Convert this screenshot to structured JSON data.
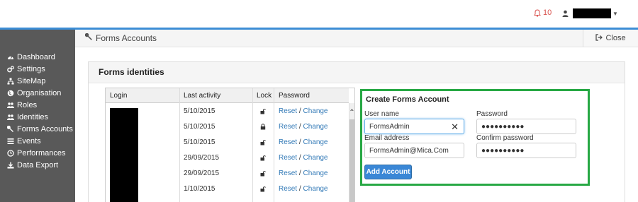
{
  "topbar": {
    "notifications_count": "10",
    "accent_color": "#3c8dd5",
    "notification_icon": "bell-icon",
    "user_icon": "user-icon"
  },
  "sidebar": {
    "items": [
      {
        "label": "Dashboard",
        "icon": "tachometer-icon"
      },
      {
        "label": "Settings",
        "icon": "cogs-icon"
      },
      {
        "label": "SiteMap",
        "icon": "sitemap-icon"
      },
      {
        "label": "Organisation",
        "icon": "globe-icon"
      },
      {
        "label": "Roles",
        "icon": "users-icon"
      },
      {
        "label": "Identities",
        "icon": "users-icon"
      },
      {
        "label": "Forms Accounts",
        "icon": "wrench-icon"
      },
      {
        "label": "Events",
        "icon": "list-icon"
      },
      {
        "label": "Performances",
        "icon": "clock-icon"
      },
      {
        "label": "Data Export",
        "icon": "download-icon"
      }
    ]
  },
  "header": {
    "title": "Forms Accounts",
    "close_label": "Close"
  },
  "panel": {
    "title": "Forms identities"
  },
  "grid": {
    "columns": [
      "Login",
      "Last activity",
      "Lock",
      "Password"
    ],
    "rows": [
      {
        "last_activity": "5/10/2015",
        "lock": "unlocked",
        "reset": "Reset",
        "sep": "/",
        "change": "Change"
      },
      {
        "last_activity": "5/10/2015",
        "lock": "locked",
        "reset": "Reset",
        "sep": "/",
        "change": "Change"
      },
      {
        "last_activity": "5/10/2015",
        "lock": "unlocked",
        "reset": "Reset",
        "sep": "/",
        "change": "Change"
      },
      {
        "last_activity": "29/09/2015",
        "lock": "unlocked",
        "reset": "Reset",
        "sep": "/",
        "change": "Change"
      },
      {
        "last_activity": "29/09/2015",
        "lock": "unlocked",
        "reset": "Reset",
        "sep": "/",
        "change": "Change"
      },
      {
        "last_activity": "1/10/2015",
        "lock": "unlocked",
        "reset": "Reset",
        "sep": "/",
        "change": "Change"
      }
    ]
  },
  "create_form": {
    "title": "Create Forms Account",
    "username_label": "User name",
    "username_value": "FormsAdmin",
    "password_label": "Password",
    "password_value": "●●●●●●●●●●",
    "email_label": "Email address",
    "email_value": "FormsAdmin@Mica.Com",
    "confirm_label": "Confirm password",
    "confirm_value": "●●●●●●●●●●",
    "submit_label": "Add Account",
    "highlight_color": "#27a844",
    "button_color": "#3a87d6"
  }
}
